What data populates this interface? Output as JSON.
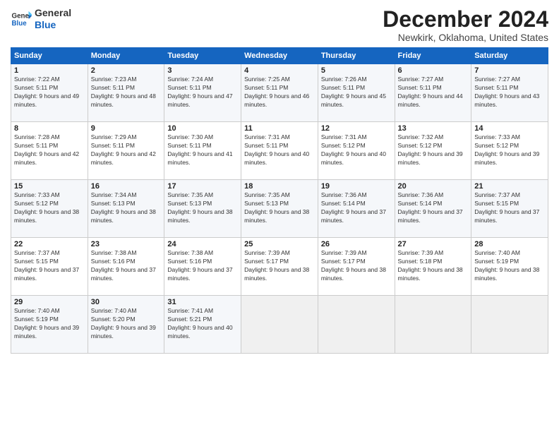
{
  "logo": {
    "line1": "General",
    "line2": "Blue"
  },
  "title": "December 2024",
  "subtitle": "Newkirk, Oklahoma, United States",
  "days_of_week": [
    "Sunday",
    "Monday",
    "Tuesday",
    "Wednesday",
    "Thursday",
    "Friday",
    "Saturday"
  ],
  "weeks": [
    [
      {
        "day": "1",
        "info": "Sunrise: 7:22 AM\nSunset: 5:11 PM\nDaylight: 9 hours and 49 minutes."
      },
      {
        "day": "2",
        "info": "Sunrise: 7:23 AM\nSunset: 5:11 PM\nDaylight: 9 hours and 48 minutes."
      },
      {
        "day": "3",
        "info": "Sunrise: 7:24 AM\nSunset: 5:11 PM\nDaylight: 9 hours and 47 minutes."
      },
      {
        "day": "4",
        "info": "Sunrise: 7:25 AM\nSunset: 5:11 PM\nDaylight: 9 hours and 46 minutes."
      },
      {
        "day": "5",
        "info": "Sunrise: 7:26 AM\nSunset: 5:11 PM\nDaylight: 9 hours and 45 minutes."
      },
      {
        "day": "6",
        "info": "Sunrise: 7:27 AM\nSunset: 5:11 PM\nDaylight: 9 hours and 44 minutes."
      },
      {
        "day": "7",
        "info": "Sunrise: 7:27 AM\nSunset: 5:11 PM\nDaylight: 9 hours and 43 minutes."
      }
    ],
    [
      {
        "day": "8",
        "info": "Sunrise: 7:28 AM\nSunset: 5:11 PM\nDaylight: 9 hours and 42 minutes."
      },
      {
        "day": "9",
        "info": "Sunrise: 7:29 AM\nSunset: 5:11 PM\nDaylight: 9 hours and 42 minutes."
      },
      {
        "day": "10",
        "info": "Sunrise: 7:30 AM\nSunset: 5:11 PM\nDaylight: 9 hours and 41 minutes."
      },
      {
        "day": "11",
        "info": "Sunrise: 7:31 AM\nSunset: 5:11 PM\nDaylight: 9 hours and 40 minutes."
      },
      {
        "day": "12",
        "info": "Sunrise: 7:31 AM\nSunset: 5:12 PM\nDaylight: 9 hours and 40 minutes."
      },
      {
        "day": "13",
        "info": "Sunrise: 7:32 AM\nSunset: 5:12 PM\nDaylight: 9 hours and 39 minutes."
      },
      {
        "day": "14",
        "info": "Sunrise: 7:33 AM\nSunset: 5:12 PM\nDaylight: 9 hours and 39 minutes."
      }
    ],
    [
      {
        "day": "15",
        "info": "Sunrise: 7:33 AM\nSunset: 5:12 PM\nDaylight: 9 hours and 38 minutes."
      },
      {
        "day": "16",
        "info": "Sunrise: 7:34 AM\nSunset: 5:13 PM\nDaylight: 9 hours and 38 minutes."
      },
      {
        "day": "17",
        "info": "Sunrise: 7:35 AM\nSunset: 5:13 PM\nDaylight: 9 hours and 38 minutes."
      },
      {
        "day": "18",
        "info": "Sunrise: 7:35 AM\nSunset: 5:13 PM\nDaylight: 9 hours and 38 minutes."
      },
      {
        "day": "19",
        "info": "Sunrise: 7:36 AM\nSunset: 5:14 PM\nDaylight: 9 hours and 37 minutes."
      },
      {
        "day": "20",
        "info": "Sunrise: 7:36 AM\nSunset: 5:14 PM\nDaylight: 9 hours and 37 minutes."
      },
      {
        "day": "21",
        "info": "Sunrise: 7:37 AM\nSunset: 5:15 PM\nDaylight: 9 hours and 37 minutes."
      }
    ],
    [
      {
        "day": "22",
        "info": "Sunrise: 7:37 AM\nSunset: 5:15 PM\nDaylight: 9 hours and 37 minutes."
      },
      {
        "day": "23",
        "info": "Sunrise: 7:38 AM\nSunset: 5:16 PM\nDaylight: 9 hours and 37 minutes."
      },
      {
        "day": "24",
        "info": "Sunrise: 7:38 AM\nSunset: 5:16 PM\nDaylight: 9 hours and 37 minutes."
      },
      {
        "day": "25",
        "info": "Sunrise: 7:39 AM\nSunset: 5:17 PM\nDaylight: 9 hours and 38 minutes."
      },
      {
        "day": "26",
        "info": "Sunrise: 7:39 AM\nSunset: 5:17 PM\nDaylight: 9 hours and 38 minutes."
      },
      {
        "day": "27",
        "info": "Sunrise: 7:39 AM\nSunset: 5:18 PM\nDaylight: 9 hours and 38 minutes."
      },
      {
        "day": "28",
        "info": "Sunrise: 7:40 AM\nSunset: 5:19 PM\nDaylight: 9 hours and 38 minutes."
      }
    ],
    [
      {
        "day": "29",
        "info": "Sunrise: 7:40 AM\nSunset: 5:19 PM\nDaylight: 9 hours and 39 minutes."
      },
      {
        "day": "30",
        "info": "Sunrise: 7:40 AM\nSunset: 5:20 PM\nDaylight: 9 hours and 39 minutes."
      },
      {
        "day": "31",
        "info": "Sunrise: 7:41 AM\nSunset: 5:21 PM\nDaylight: 9 hours and 40 minutes."
      },
      null,
      null,
      null,
      null
    ]
  ]
}
